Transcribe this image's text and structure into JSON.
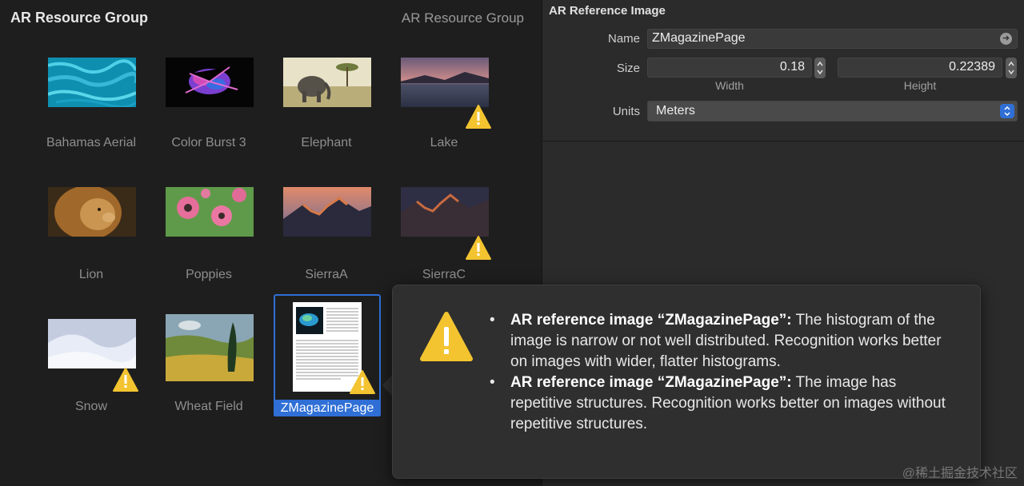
{
  "left": {
    "title": "AR Resource Group",
    "title_right": "AR Resource Group"
  },
  "images": [
    {
      "name": "Bahamas Aerial",
      "warning": false
    },
    {
      "name": "Color Burst 3",
      "warning": false
    },
    {
      "name": "Elephant",
      "warning": false
    },
    {
      "name": "Lake",
      "warning": true
    },
    {
      "name": "Lion",
      "warning": false
    },
    {
      "name": "Poppies",
      "warning": false
    },
    {
      "name": "SierraA",
      "warning": false
    },
    {
      "name": "SierraC",
      "warning": true
    },
    {
      "name": "Snow",
      "warning": true
    },
    {
      "name": "Wheat Field",
      "warning": false
    },
    {
      "name": "ZMagazinePage",
      "warning": true,
      "selected": true
    }
  ],
  "inspector": {
    "title": "AR Reference Image",
    "name_label": "Name",
    "name_value": "ZMagazinePage",
    "size_label": "Size",
    "width_value": "0.18",
    "height_value": "0.22389",
    "width_label": "Width",
    "height_label": "Height",
    "units_label": "Units",
    "units_value": "Meters"
  },
  "popover": {
    "warnings": [
      {
        "bold": "AR reference image “ZMagazinePage”:",
        "text": " The histogram of the image is narrow or not well distributed. Recognition works better on images with wider, flatter histograms."
      },
      {
        "bold": "AR reference image “ZMagazinePage”:",
        "text": " The image has repetitive structures. Recognition works better on images without repetitive structures."
      }
    ]
  },
  "watermark": "@稀土掘金技术社区",
  "colors": {
    "selection": "#2f6fd6",
    "warning": "#f3c430"
  }
}
